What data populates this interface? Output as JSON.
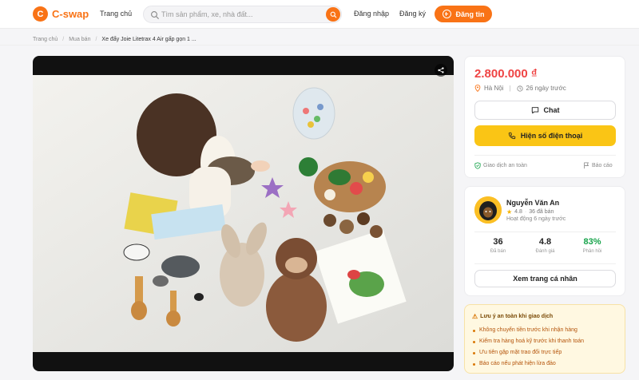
{
  "header": {
    "logo_letter": "C",
    "logo_text": "C-swap",
    "nav_home": "Trang chủ",
    "search_placeholder": "Tìm sản phẩm, xe, nhà đất...",
    "login": "Đăng nhập",
    "register": "Đăng ký",
    "post": "Đăng tin"
  },
  "breadcrumb": {
    "items": [
      "Trang chủ",
      "Mua bán"
    ],
    "current": "Xe đẩy Joie Litetrax 4 Air gấp gọn 1 ..."
  },
  "listing": {
    "price": "2.800.000 ₫",
    "location": "Hà Nội",
    "posted": "26 ngày trước",
    "chat_label": "Chat",
    "phone_label": "Hiện số điện thoại",
    "safe_trade": "Giao dịch an toàn",
    "report": "Báo cáo"
  },
  "seller": {
    "name": "Nguyễn Văn An",
    "rating": "4.8",
    "sold_count": "36 đã bán",
    "active": "Hoạt động 6 ngày trước",
    "stats": [
      {
        "value": "36",
        "label": "Đã bán"
      },
      {
        "value": "4.8",
        "label": "Đánh giá"
      },
      {
        "value": "83%",
        "label": "Phản hồi"
      }
    ],
    "profile_button": "Xem trang cá nhân"
  },
  "tips": {
    "title": "Lưu ý an toàn khi giao dịch",
    "items": [
      "Không chuyển tiền trước khi nhận hàng",
      "Kiểm tra hàng hoá kỹ trước khi thanh toán",
      "Ưu tiên gặp mặt trao đổi trực tiếp",
      "Báo cáo nếu phát hiện lừa đảo"
    ]
  },
  "colors": {
    "brand": "#f97316",
    "price": "#ef4444",
    "phone_button": "#fac515",
    "positive": "#16a34a",
    "warning_bg": "#fff8e1"
  }
}
